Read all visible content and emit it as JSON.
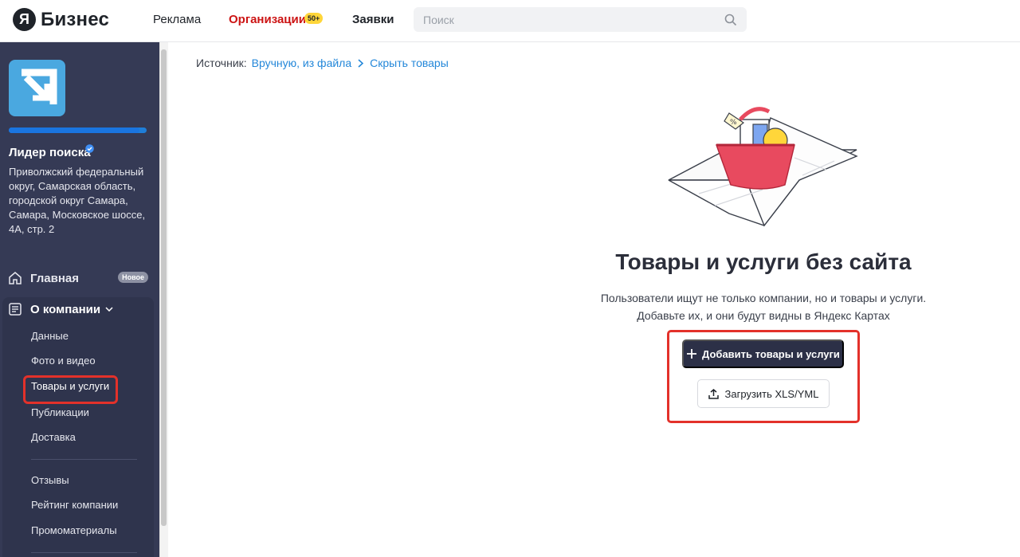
{
  "header": {
    "logo_letter": "Я",
    "logo_text": "Бизнес",
    "nav": {
      "ads": "Реклама",
      "orgs": "Организации",
      "orgs_badge": "50+",
      "requests": "Заявки"
    },
    "search": {
      "placeholder": "Поиск",
      "value": ""
    }
  },
  "sidebar": {
    "company_name": "Лидер поиска",
    "address": "Приволжский федеральный округ, Самарская область, городской округ Самара, Самара, Московское шоссе, 4А, стр. 2",
    "profile_progress": 0.95,
    "main": {
      "label": "Главная",
      "badge": "Новое"
    },
    "about": {
      "label": "О компании",
      "items": [
        "Данные",
        "Фото и видео",
        "Товары и услуги",
        "Публикации",
        "Доставка"
      ],
      "items2": [
        "Отзывы",
        "Рейтинг компании",
        "Промоматериалы"
      ]
    }
  },
  "content": {
    "breadcrumb": {
      "label": "Источник:",
      "source": "Вручную, из файла",
      "hide": "Скрыть товары"
    },
    "title": "Товары и услуги без сайта",
    "desc_line1": "Пользователи ищут не только компании, но и товары и услуги.",
    "desc_line2": "Добавьте их, и они будут видны в Яндекс Картах",
    "btn_add": "Добавить товары и услуги",
    "btn_upload": "Загрузить XLS/YML"
  },
  "colors": {
    "sidebar": "#353a55",
    "accent_red": "#cc1414",
    "link": "#2387d9",
    "highlight": "#e3312a",
    "primary_btn": "#2c3047"
  },
  "icons": [
    "search-icon",
    "home-icon",
    "document-icon",
    "chevron-down-icon",
    "chevron-right-icon",
    "plus-icon",
    "upload-icon",
    "verified-icon"
  ]
}
